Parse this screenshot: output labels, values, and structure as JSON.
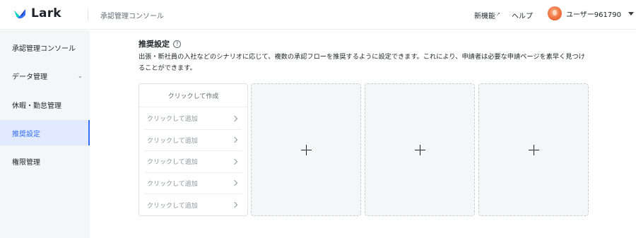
{
  "header": {
    "brand": "Lark",
    "console_title": "承認管理コンソール",
    "nav_new": "新機能",
    "nav_new_ext": "↗",
    "nav_help": "ヘルプ",
    "user_name": "ユーザー961790"
  },
  "sidebar": {
    "items": [
      {
        "label": "承認管理コンソール"
      },
      {
        "label": "データ管理",
        "caret": "⌄"
      },
      {
        "label": "休暇・勤怠管理"
      },
      {
        "label": "推奨設定",
        "active": true
      },
      {
        "label": "権限管理"
      }
    ]
  },
  "main": {
    "title": "推奨設定",
    "help_icon_char": "?",
    "description": "出張・新社員の入社などのシナリオに応じて、複数の承認フローを推奨するように設定できます。これにより、申請者は必要な申請ページを素早く見つけることができます。",
    "flow_card": {
      "create_label": "クリックして作成",
      "rows": [
        "クリックして追加",
        "クリックして追加",
        "クリックして追加",
        "クリックして追加",
        "クリックして追加"
      ]
    }
  }
}
